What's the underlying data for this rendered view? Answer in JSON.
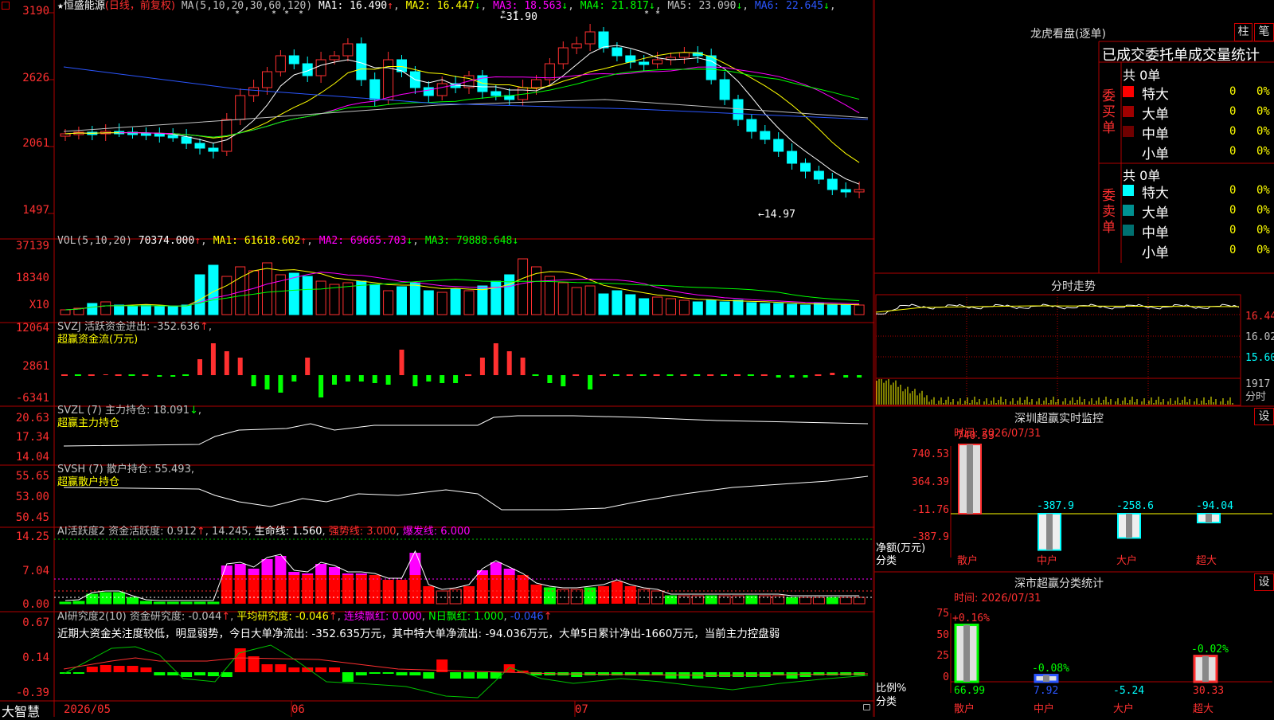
{
  "stock": {
    "star": "★",
    "name": "恒盛能源",
    "mode": "(日线，前复权)"
  },
  "main": {
    "ma_text": "MA(5,10,20,30,60,120)",
    "ma": [
      {
        "label": "MA1: 16.490",
        "arrow": "↑",
        "color": "#ffffff"
      },
      {
        "label": "MA2: 16.447",
        "arrow": "↓",
        "color": "#ffff00"
      },
      {
        "label": "MA3: 18.563",
        "arrow": "↓",
        "color": "#ff00ff"
      },
      {
        "label": "MA4: 21.817",
        "arrow": "↓",
        "color": "#00ff00"
      },
      {
        "label": "MA5: 23.090",
        "arrow": "↓",
        "color": "#c0c0c0"
      },
      {
        "label": "MA6: 22.645",
        "arrow": "↓",
        "color": "#2b56ff"
      }
    ],
    "y_labels": [
      "3190",
      "2626",
      "2061",
      "1497"
    ],
    "high_label": "←31.90",
    "low_label": "←14.97"
  },
  "vol": {
    "title": "VOL(5,10,20)",
    "value": "70374.000",
    "ma1": "MA1: 61618.602",
    "ma2": "MA2: 69665.703",
    "ma3": "MA3: 79888.648",
    "y_labels": [
      "37139",
      "18340",
      "X10"
    ]
  },
  "svzj": {
    "title": "SVZJ  活跃资金进出: -352.636",
    "sub": "超赢资金流(万元)",
    "y_labels": [
      "12064",
      "2861",
      "-6341"
    ]
  },
  "svzl": {
    "title": "SVZL (7) 主力持仓: 18.091",
    "sub": "超赢主力持仓",
    "y_labels": [
      "20.63",
      "17.34",
      "14.04"
    ]
  },
  "svsh": {
    "title": "SVSH (7) 散户持仓: 55.493",
    "sub": "超赢散户持仓",
    "y_labels": [
      "55.65",
      "53.00",
      "50.45"
    ]
  },
  "ai1": {
    "title": "AI活跃度2 资金活跃度: 0.912",
    "v2": "14.245",
    "v3": "生命线: 1.560",
    "v4": "强势线: 3.000",
    "v5": "爆发线: 6.000",
    "y_labels": [
      "14.25",
      "7.04",
      "0.00"
    ]
  },
  "ai2": {
    "title": "AI研究度2(10) 资金研究度: -0.044",
    "v2": "平均研究度: -0.046",
    "v3": "连续飘红: 0.000",
    "v4": "N日飘红: 1.000",
    "v5": "-0.046",
    "note": "近期大资金关注度较低，明显弱势，今日大单净流出: -352.635万元，其中特大单净流出: -94.036万元，大单5日累计净出-1660万元，当前主力控盘弱",
    "y_labels": [
      "0.67",
      "0.14",
      "-0.39"
    ]
  },
  "bottom": {
    "brand": "大智慧",
    "dates": [
      "2026/05",
      "06",
      "07"
    ]
  },
  "dragon": {
    "title": "龙虎看盘(逐单)",
    "btn1": "柱",
    "btn2": "笔",
    "header": "已成交委托单成交量统计",
    "buy_label": "委买单",
    "sell_label": "委卖单",
    "buy_total": "共 0单",
    "sell_total": "共 0单",
    "buy_rows": [
      {
        "name": "特大",
        "n": "0",
        "p": "0%",
        "color": "#ff0000"
      },
      {
        "name": "大单",
        "n": "0",
        "p": "0%",
        "color": "#a00000"
      },
      {
        "name": "中单",
        "n": "0",
        "p": "0%",
        "color": "#700000"
      },
      {
        "name": "小单",
        "n": "0",
        "p": "0%",
        "color": "#000000"
      }
    ],
    "sell_rows": [
      {
        "name": "特大",
        "n": "0",
        "p": "0%",
        "color": "#00ffff"
      },
      {
        "name": "大单",
        "n": "0",
        "p": "0%",
        "color": "#009090"
      },
      {
        "name": "中单",
        "n": "0",
        "p": "0%",
        "color": "#007070"
      },
      {
        "name": "小单",
        "n": "0",
        "p": "0%",
        "color": "#000000"
      }
    ]
  },
  "intraday": {
    "title": "分时走势",
    "y_labels": [
      "16.44",
      "16.02",
      "15.60",
      "1917",
      "分时"
    ]
  },
  "monitor": {
    "title": "深圳超赢实时监控",
    "btn": "设",
    "time": "时间: 2026/07/31",
    "y_labels": [
      "740.53",
      "364.39",
      "-11.76",
      "-387.9"
    ],
    "axis_label": "净额(万元)",
    "cat_label": "分类",
    "bars": [
      {
        "name": "散户",
        "value": "740.53",
        "v": 740.53
      },
      {
        "name": "中户",
        "value": "-387.9",
        "v": -387.9
      },
      {
        "name": "大户",
        "value": "-258.6",
        "v": -258.6
      },
      {
        "name": "超大",
        "value": "-94.04",
        "v": -94.04
      }
    ]
  },
  "classify": {
    "title": "深市超赢分类统计",
    "btn": "设",
    "time": "时间: 2026/07/31",
    "y_labels": [
      "75",
      "50",
      "25",
      "0"
    ],
    "axis_label": "比例%",
    "cat_label": "分类",
    "bars": [
      {
        "name": "散户",
        "top": "+0.16%",
        "bottom": "66.99",
        "v": 66.99
      },
      {
        "name": "中户",
        "top": "-0.08%",
        "bottom": "7.92",
        "v": 7.92
      },
      {
        "name": "大户",
        "top": "",
        "bottom": "-5.24",
        "v": 0
      },
      {
        "name": "超大",
        "top": "-0.02%",
        "bottom": "30.33",
        "v": 30.33
      }
    ]
  }
}
